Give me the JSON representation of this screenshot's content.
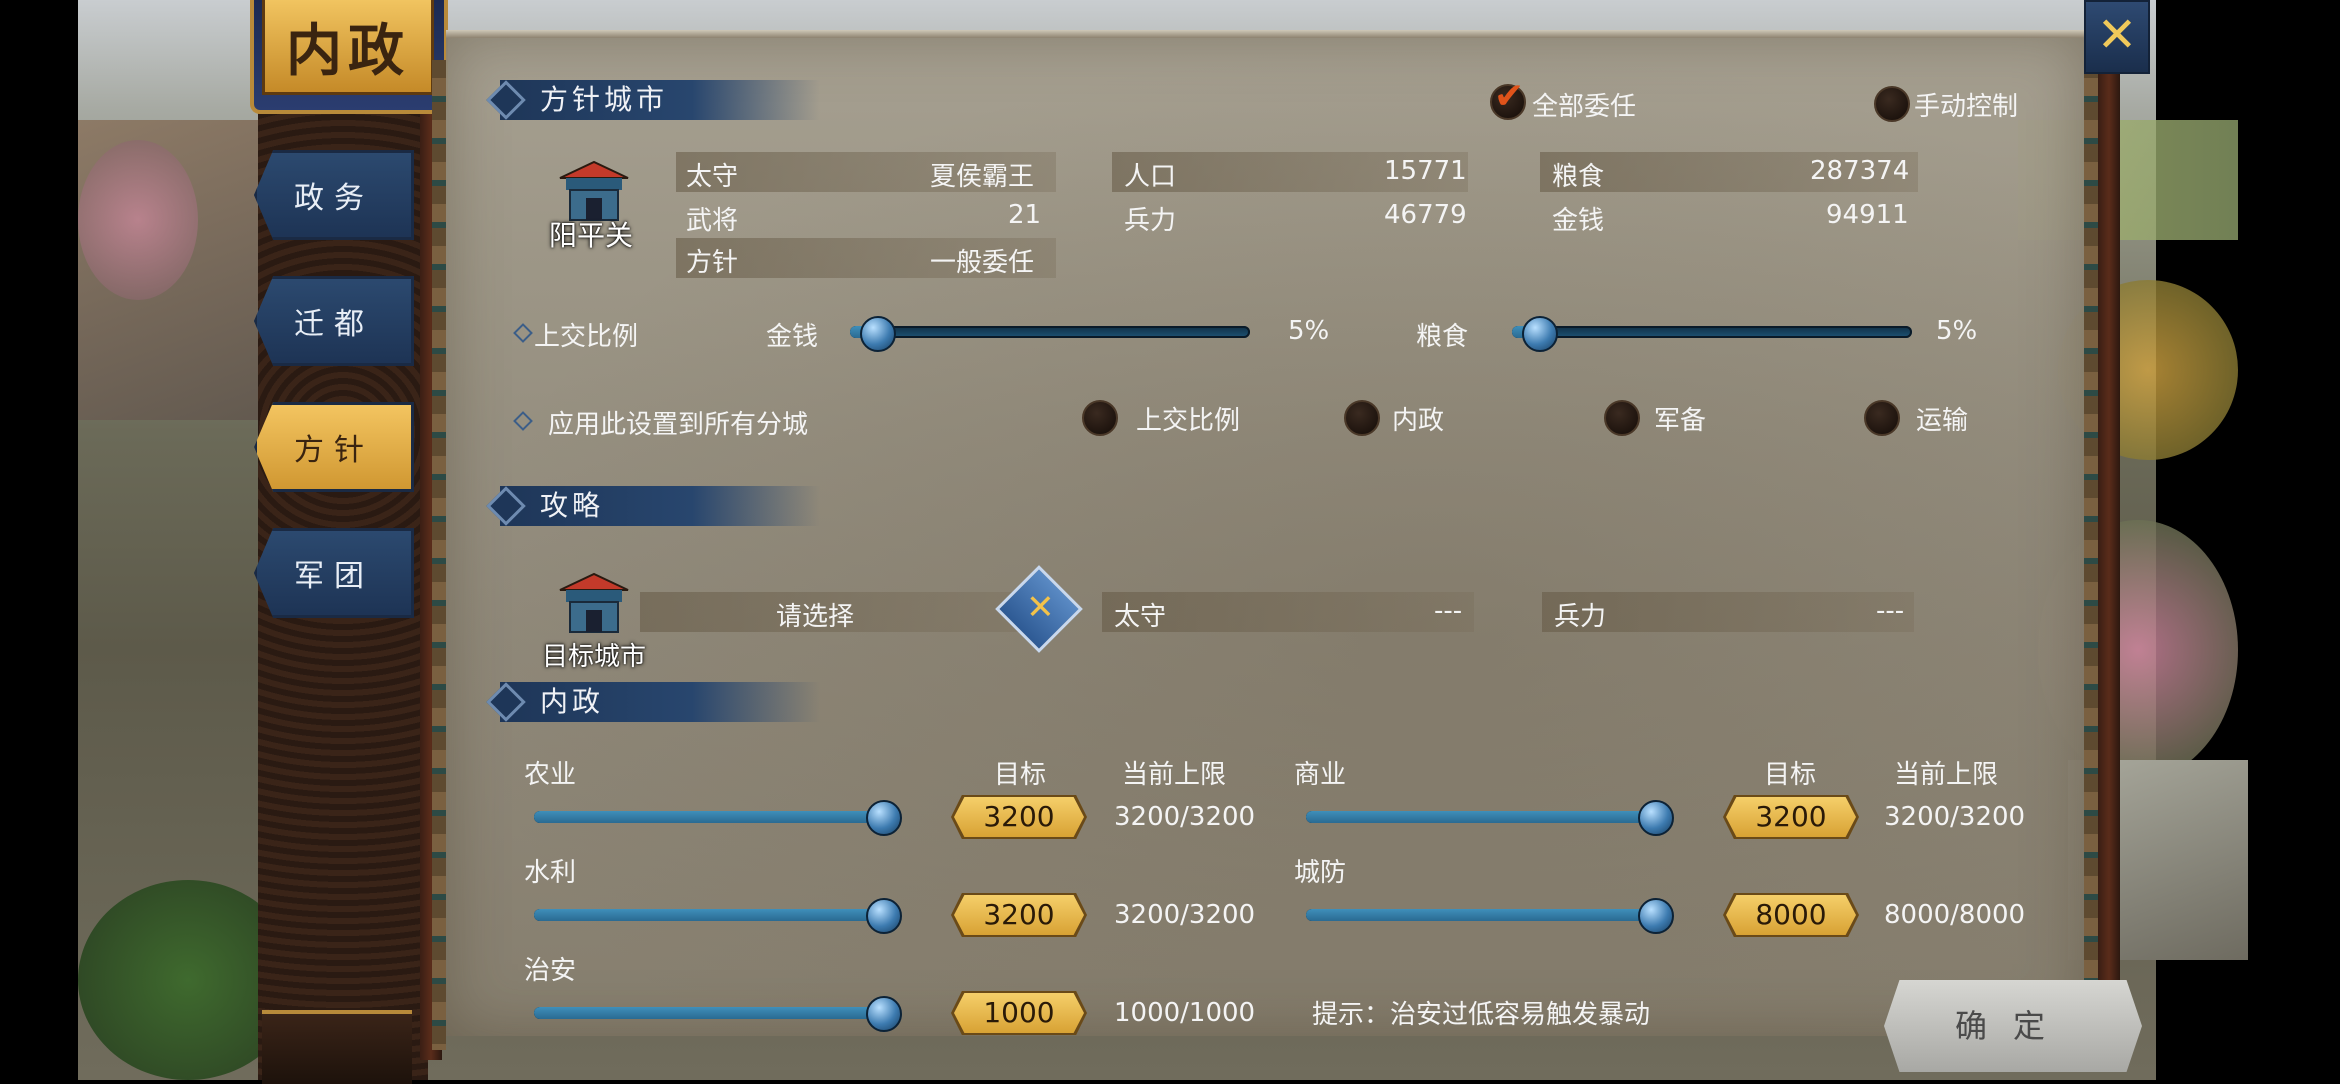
{
  "title": "内政",
  "tabs": [
    {
      "label": "政务",
      "active": false
    },
    {
      "label": "迁都",
      "active": false
    },
    {
      "label": "方针",
      "active": true
    },
    {
      "label": "军团",
      "active": false
    }
  ],
  "policy_city": {
    "section_title": "方针城市",
    "delegate_all": "全部委任",
    "manual_control": "手动控制",
    "city_name": "阳平关",
    "stats": {
      "governor_label": "太守",
      "governor_value": "夏侯霸王",
      "generals_label": "武将",
      "generals_value": "21",
      "policy_label": "方针",
      "policy_value": "一般委任",
      "population_label": "人口",
      "population_value": "15771",
      "troops_label": "兵力",
      "troops_value": "46779",
      "food_label": "粮食",
      "food_value": "287374",
      "money_label": "金钱",
      "money_value": "94911"
    },
    "tribute": {
      "label": "上交比例",
      "money_label": "金钱",
      "money_value": "5%",
      "money_fraction": 0.05,
      "food_label": "粮食",
      "food_value": "5%",
      "food_fraction": 0.05
    },
    "apply_all": {
      "label": "应用此设置到所有分城",
      "options": [
        "上交比例",
        "内政",
        "军备",
        "运输"
      ]
    }
  },
  "strategy": {
    "section_title": "攻略",
    "target_label": "目标城市",
    "select_placeholder": "请选择",
    "governor_label": "太守",
    "governor_value": "---",
    "troops_label": "兵力",
    "troops_value": "---"
  },
  "domestic": {
    "section_title": "内政",
    "target_header": "目标",
    "limit_header": "当前上限",
    "items": [
      {
        "name": "农业",
        "target": "3200",
        "limit": "3200/3200",
        "level": 1.0
      },
      {
        "name": "商业",
        "target": "3200",
        "limit": "3200/3200",
        "level": 1.0
      },
      {
        "name": "水利",
        "target": "3200",
        "limit": "3200/3200",
        "level": 1.0
      },
      {
        "name": "城防",
        "target": "8000",
        "limit": "8000/8000",
        "level": 1.0
      },
      {
        "name": "治安",
        "target": "1000",
        "limit": "1000/1000",
        "level": 1.0
      }
    ],
    "hint": "提示：治安过低容易触发暴动"
  },
  "confirm_label": "确定",
  "close_icon": "close-x-icon",
  "colors": {
    "accent_gold": "#f2b928",
    "tab_blue": "#1d3354",
    "slider_blue": "#2a6a92"
  }
}
